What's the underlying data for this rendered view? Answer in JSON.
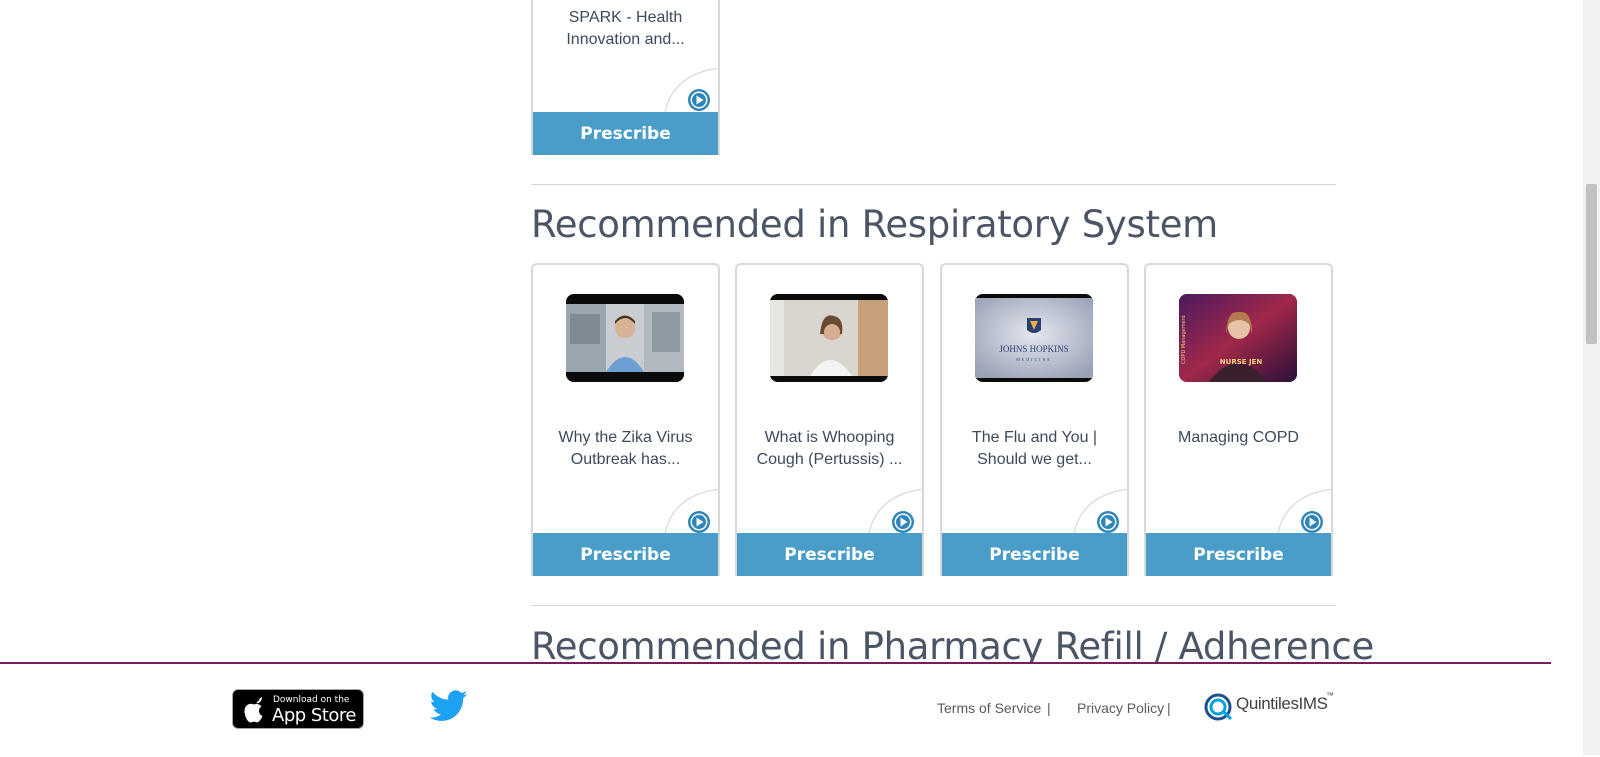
{
  "top_card": {
    "title": "SPARK - Health Innovation and...",
    "button": "Prescribe"
  },
  "section_respiratory": {
    "title": "Recommended in Respiratory System",
    "cards": [
      {
        "title": "Why the Zika Virus Outbreak has...",
        "button": "Prescribe"
      },
      {
        "title": "What is Whooping Cough (Pertussis) ...",
        "button": "Prescribe"
      },
      {
        "title": "The Flu and You | Should we get...",
        "button": "Prescribe",
        "thumb_logo": "JOHNS HOPKINS",
        "thumb_logo_sub": "MEDICINE"
      },
      {
        "title": "Managing COPD",
        "button": "Prescribe",
        "thumb_caption": "NURSE JEN",
        "thumb_side": "COPD Management"
      }
    ]
  },
  "section_pharmacy": {
    "title": "Recommended in Pharmacy Refill / Adherence"
  },
  "footer": {
    "app_store_small": "Download on the",
    "app_store_big": "App Store",
    "terms": "Terms of Service",
    "privacy": "Privacy Policy",
    "separator": "|",
    "brand": "QuintilesIMS",
    "brand_tm": "™"
  },
  "colors": {
    "accent": "#4a9dc8",
    "footer_border": "#7b1c5a",
    "text": "#3d4a5c"
  }
}
